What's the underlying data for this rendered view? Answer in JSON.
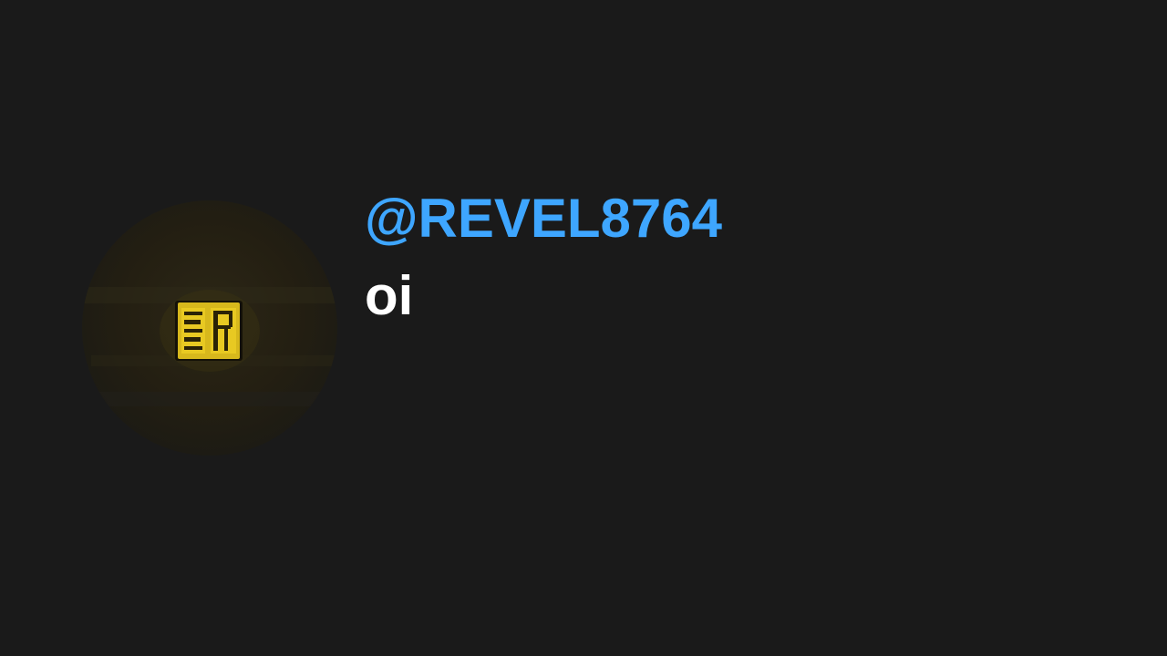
{
  "comment": {
    "username": "@REVEL8764",
    "text": "oi",
    "username_color": "#3ea6ff",
    "text_color": "#ffffff"
  },
  "avatar": {
    "icon": "br-logo-avatar-icon",
    "accent": "#e6c21a"
  },
  "background": "#1a1a1a"
}
